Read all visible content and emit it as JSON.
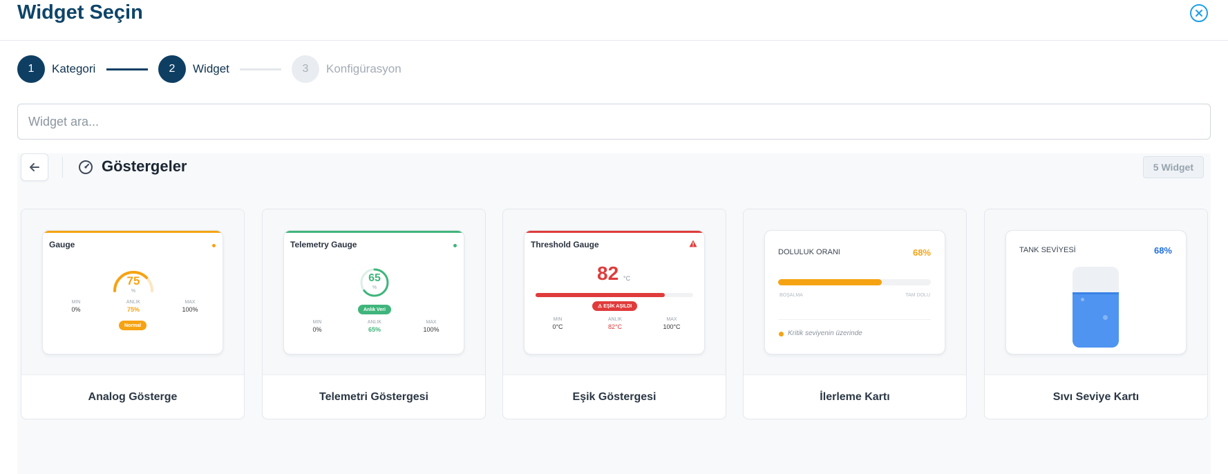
{
  "header": {
    "title": "Widget Seçin",
    "close_icon": "close-circle-icon"
  },
  "stepper": {
    "steps": [
      {
        "number": "1",
        "label": "Kategori",
        "state": "completed"
      },
      {
        "number": "2",
        "label": "Widget",
        "state": "active"
      },
      {
        "number": "3",
        "label": "Konfigürasyon",
        "state": "inactive"
      }
    ]
  },
  "search": {
    "placeholder": "Widget ara...",
    "value": ""
  },
  "category": {
    "title": "Göstergeler",
    "icon": "gauge-icon",
    "count_label": "5 Widget"
  },
  "colors": {
    "primary": "#0e3f63",
    "orange": "#f5a313",
    "green": "#3fb57b",
    "red": "#e03b3b",
    "blue": "#1f6fdc"
  },
  "widgets": [
    {
      "name": "Analog Gösterge",
      "preview": {
        "title": "Gauge",
        "value": "75",
        "unit": "%",
        "min_label": "MIN",
        "min": "0%",
        "now_label": "ANLIK",
        "now": "75%",
        "max_label": "MAX",
        "max": "100%",
        "status": "Normal",
        "level": 0.75
      }
    },
    {
      "name": "Telemetri Göstergesi",
      "preview": {
        "title": "Telemetry Gauge",
        "value": "65",
        "unit": "%",
        "badge": "Anlık Veri",
        "min_label": "MIN",
        "min": "0%",
        "now_label": "ANLIK",
        "now": "65%",
        "max_label": "MAX",
        "max": "100%",
        "level": 0.65
      }
    },
    {
      "name": "Eşik Göstergesi",
      "preview": {
        "title": "Threshold Gauge",
        "value": "82",
        "unit": "°C",
        "alert": "EŞİK AŞILDI",
        "min_label": "MIN",
        "min": "0°C",
        "now_label": "ANLIK",
        "now": "82°C",
        "max_label": "MAX",
        "max": "100°C",
        "level": 0.82
      }
    },
    {
      "name": "İlerleme Kartı",
      "preview": {
        "title": "DOLULUK ORANI",
        "value": "68%",
        "left_label": "BOŞALMA",
        "right_label": "TAM DOLU",
        "note": "Kritik seviyenin üzerinde",
        "level": 0.68
      }
    },
    {
      "name": "Sıvı Seviye Kartı",
      "preview": {
        "title": "TANK SEVİYESİ",
        "value": "68%",
        "level": 0.68
      }
    }
  ]
}
